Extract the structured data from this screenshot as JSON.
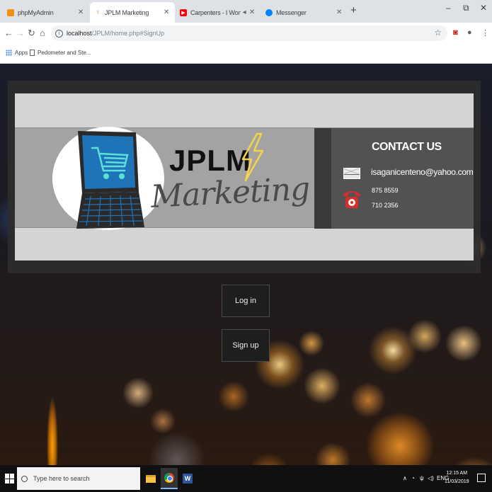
{
  "browser": {
    "tabs": [
      {
        "title": "phpMyAdmin",
        "icon": "phpmyadmin-icon",
        "active": false
      },
      {
        "title": "JPLM Marketing",
        "icon": "bulb-icon",
        "active": true
      },
      {
        "title": "Carpenters - I Won't Last A D",
        "icon": "youtube-icon",
        "active": false
      },
      {
        "title": "Messenger",
        "icon": "messenger-icon",
        "active": false
      }
    ],
    "new_tab_label": "+",
    "window_controls": {
      "minimize": "–",
      "restore": "⧉",
      "close": "✕"
    },
    "address": {
      "host": "localhost",
      "path": "/JPLM/home.php#SignUp"
    },
    "bookmarks": [
      {
        "label": "Apps",
        "icon": "apps-grid-icon"
      },
      {
        "label": "Pedometer and Ste...",
        "icon": "page-icon"
      }
    ]
  },
  "page": {
    "logo": {
      "line1": "JPLM",
      "line2": "Marketing"
    },
    "contact": {
      "title": "CONTACT US",
      "email": "isaganicenteno@yahoo.com",
      "phones": [
        "875 8559",
        "710 2356"
      ]
    },
    "buttons": {
      "login": "Log in",
      "signup": "Sign up"
    }
  },
  "taskbar": {
    "search_placeholder": "Type here to search",
    "tray_lang": "ENG",
    "time": "12:15 AM",
    "date": "11/03/2019"
  },
  "colors": {
    "tab_strip": "#dee1e6",
    "banner_light": "#d4d4d4",
    "banner_band": "#a3a3a3",
    "contact_bg": "#525252",
    "laptop_screen": "#1f74b8",
    "cart": "#5ce0d8",
    "bolt": "#f3d34a",
    "button_bg": "#1e1e1e"
  }
}
